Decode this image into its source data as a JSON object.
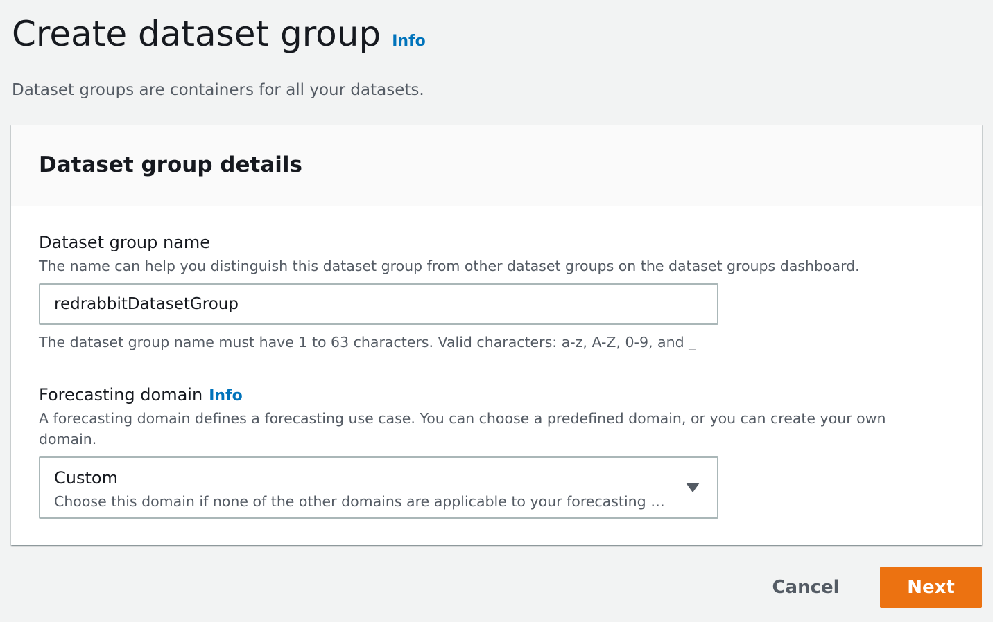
{
  "header": {
    "title": "Create dataset group",
    "info_label": "Info",
    "description": "Dataset groups are containers for all your datasets."
  },
  "panel": {
    "title": "Dataset group details",
    "name_field": {
      "label": "Dataset group name",
      "description": "The name can help you distinguish this dataset group from other dataset groups on the dataset groups dashboard.",
      "value": "redrabbitDatasetGroup",
      "constraint": "The dataset group name must have 1 to 63 characters. Valid characters: a-z, A-Z, 0-9, and _"
    },
    "domain_field": {
      "label": "Forecasting domain",
      "info_label": "Info",
      "description": "A forecasting domain defines a forecasting use case. You can choose a predefined domain, or you can create your own domain.",
      "selected_value": "Custom",
      "selected_description": "Choose this domain if none of the other domains are applicable to your forecasting scenario."
    }
  },
  "actions": {
    "cancel_label": "Cancel",
    "next_label": "Next"
  },
  "colors": {
    "accent": "#ec7211",
    "link": "#0073bb",
    "background": "#f2f3f3"
  }
}
